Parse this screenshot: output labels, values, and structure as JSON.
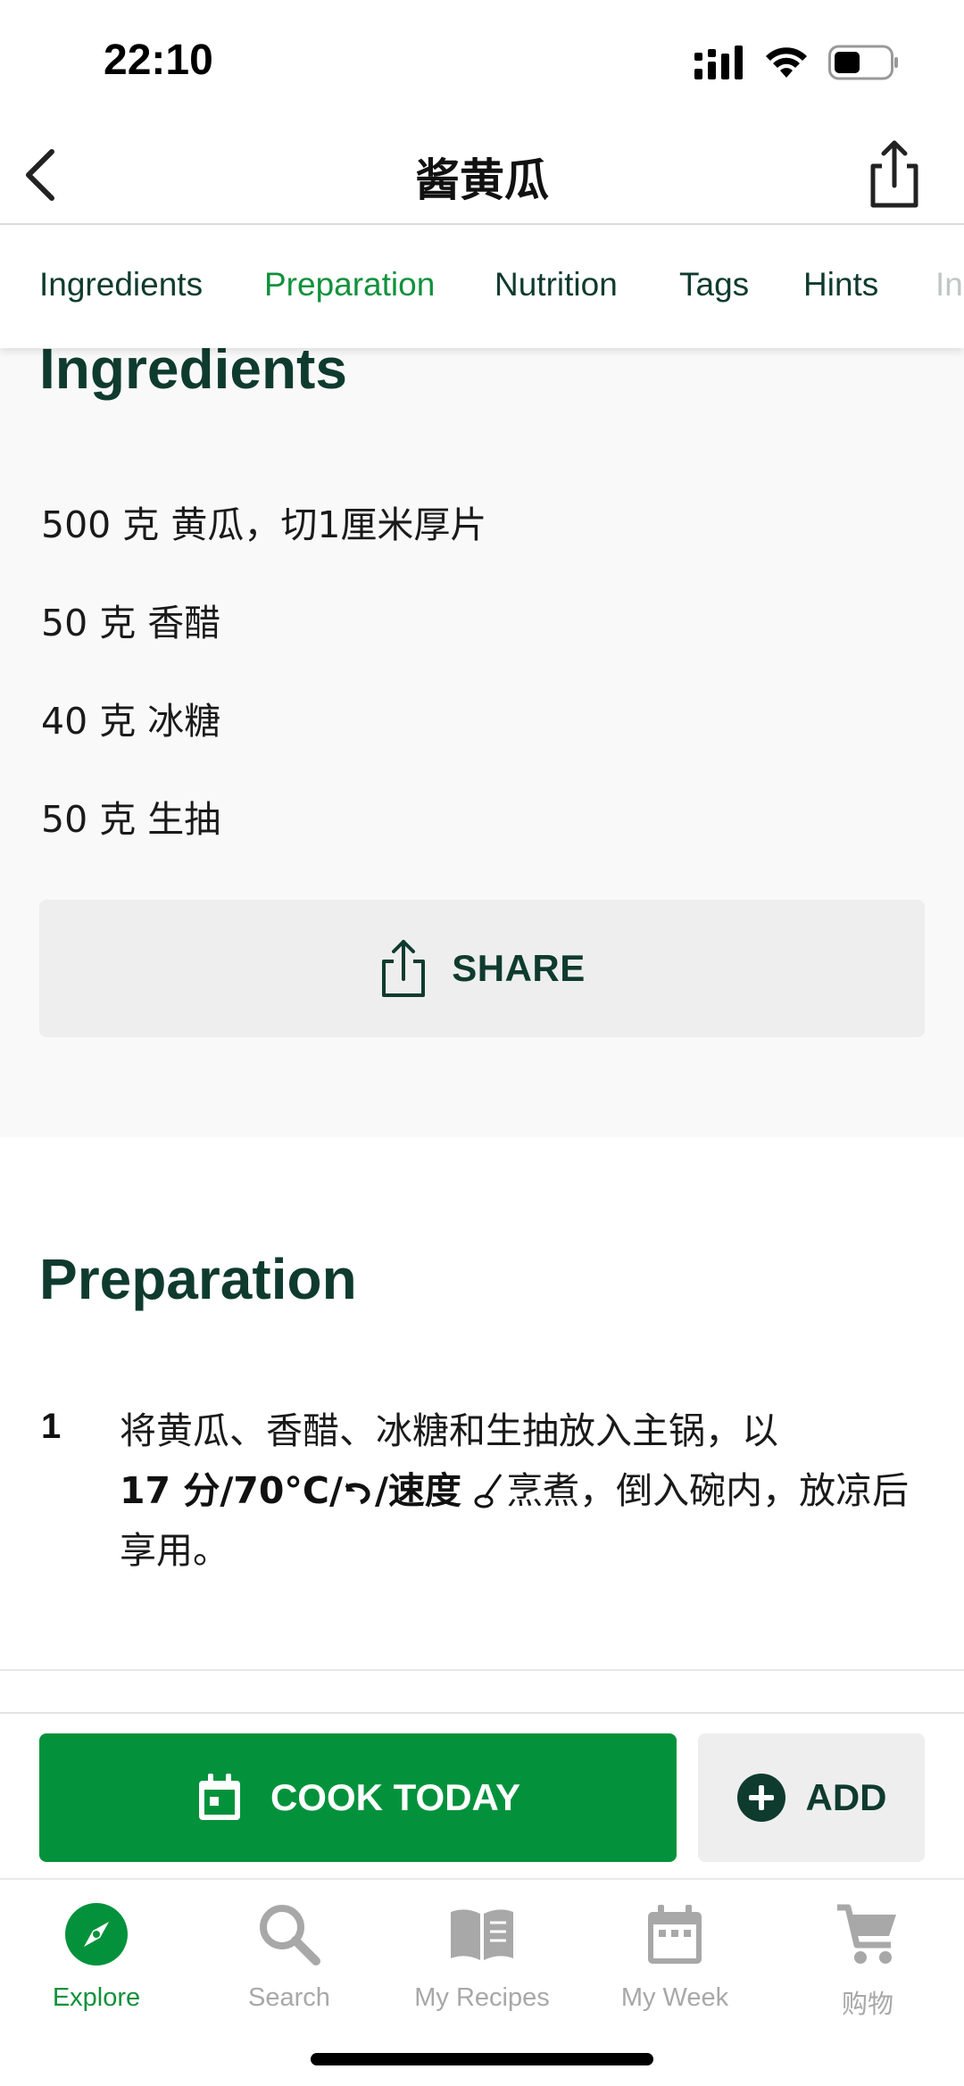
{
  "status_bar": {
    "time": "22:10"
  },
  "header": {
    "title": "酱黄瓜"
  },
  "tabs": [
    {
      "label": "Ingredients"
    },
    {
      "label": "Preparation"
    },
    {
      "label": "Nutrition"
    },
    {
      "label": "Tags"
    },
    {
      "label": "Hints"
    },
    {
      "label": "In"
    }
  ],
  "ingredients": {
    "title": "Ingredients",
    "items": [
      "500 克 黄瓜，切1厘米厚片",
      "50 克 香醋",
      "40 克 冰糖",
      "50 克 生抽"
    ],
    "share_label": "SHARE"
  },
  "preparation": {
    "title": "Preparation",
    "steps": [
      {
        "number": "1",
        "text_before": "将黄瓜、香醋、冰糖和生抽放入主锅，以",
        "settings_a": "17 分/70°C/",
        "settings_b": "/速度 ",
        "text_after": "烹煮，倒入碗内，放凉后享用。"
      }
    ]
  },
  "actions": {
    "cook_label": "COOK TODAY",
    "add_label": "ADD",
    "accent": "#03923b"
  },
  "nav": [
    {
      "label": "Explore",
      "icon": "compass-icon",
      "active": true
    },
    {
      "label": "Search",
      "icon": "search-icon"
    },
    {
      "label": "My Recipes",
      "icon": "open-book-icon"
    },
    {
      "label": "My Week",
      "icon": "calendar-icon"
    },
    {
      "label": "购物",
      "icon": "cart-icon"
    }
  ]
}
